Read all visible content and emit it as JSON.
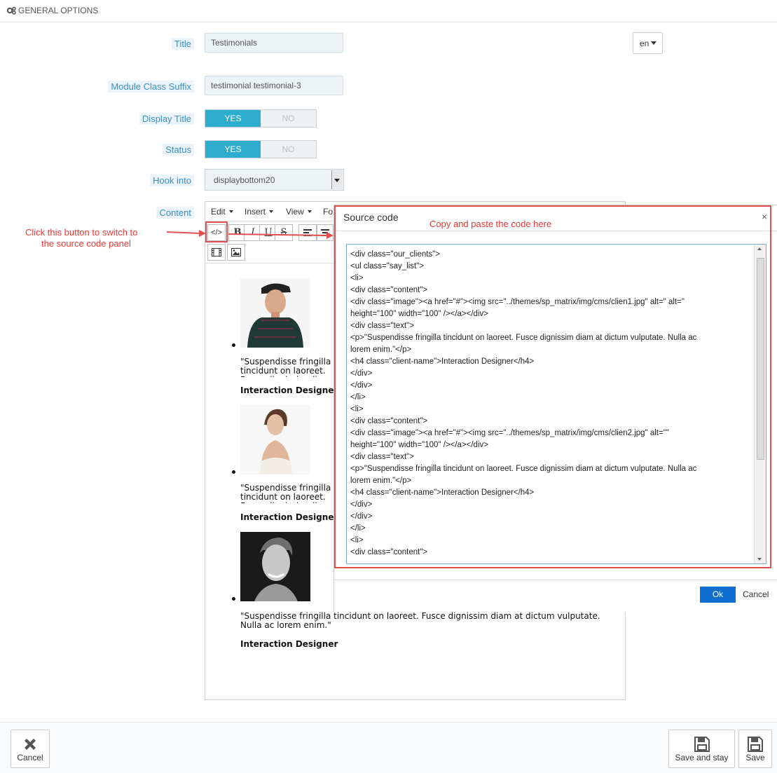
{
  "panel": {
    "title": "GENERAL OPTIONS",
    "icon": "cogs-icon"
  },
  "language": {
    "selected": "en"
  },
  "fields": {
    "title": {
      "label": "Title",
      "value": "Testimonials"
    },
    "class_suffix": {
      "label": "Module Class Suffix",
      "value": "testimonial testimonial-3"
    },
    "display_title": {
      "label": "Display Title",
      "yes": "YES",
      "no": "NO",
      "value": "YES"
    },
    "status": {
      "label": "Status",
      "yes": "YES",
      "no": "NO",
      "value": "YES"
    },
    "hook": {
      "label": "Hook into",
      "value": "displaybottom20"
    },
    "content": {
      "label": "Content"
    }
  },
  "editor": {
    "menu": [
      "Edit",
      "Insert",
      "View",
      "Fo"
    ],
    "toolbar": {
      "code": "</>",
      "bold": "B",
      "italic": "I",
      "underline": "U",
      "strike": "S"
    },
    "items": [
      {
        "text": "\"Suspendisse fringilla tincidunt on laoreet. Fusce dignissim diam at dictum vulputate. Nulla ac lorem enim.\"",
        "name": "Interaction Designer"
      },
      {
        "text": "\"Suspendisse fringilla tincidunt on laoreet. Fusce dignissim diam at dictum vulputate. Nulla ac lorem enim.\"",
        "name": "Interaction Designer"
      },
      {
        "text": "\"Suspendisse fringilla tincidunt on laoreet. Fusce dignissim diam at dictum vulputate. Nulla ac lorem enim.\"",
        "name": "Interaction Designer"
      }
    ]
  },
  "source_modal": {
    "title": "Source code",
    "close": "×",
    "ok": "Ok",
    "cancel": "Cancel",
    "code": "<div class=\"our_clients\">\n<ul class=\"say_list\">\n<li>\n<div class=\"content\">\n<div class=\"image\"><a href=\"#\"><img src=\"../themes/sp_matrix/img/cms/clien1.jpg\" alt=\" alt=\"\nheight=\"100\" width=\"100\" /></a></div>\n<div class=\"text\">\n<p>\"Suspendisse fringilla tincidunt on laoreet. Fusce dignissim diam at dictum vulputate. Nulla ac\nlorem enim.\"</p>\n<h4 class=\"client-name\">Interaction Designer</h4>\n</div>\n</div>\n</li>\n<li>\n<div class=\"content\">\n<div class=\"image\"><a href=\"#\"><img src=\"../themes/sp_matrix/img/cms/clien2.jpg\" alt=\"\"\nheight=\"100\" width=\"100\" /></a></div>\n<div class=\"text\">\n<p>\"Suspendisse fringilla tincidunt on laoreet. Fusce dignissim diam at dictum vulputate. Nulla ac\nlorem enim.\"</p>\n<h4 class=\"client-name\">Interaction Designer</h4>\n</div>\n</div>\n</li>\n<li>\n<div class=\"content\">"
  },
  "annotations": {
    "switch_hint_1": "Click this button to switch to",
    "switch_hint_2": "the source code panel",
    "paste_hint": "Copy and paste the code here",
    "color": "#e53935"
  },
  "footer": {
    "cancel": "Cancel",
    "save_and_stay": "Save and stay",
    "save": "Save"
  }
}
